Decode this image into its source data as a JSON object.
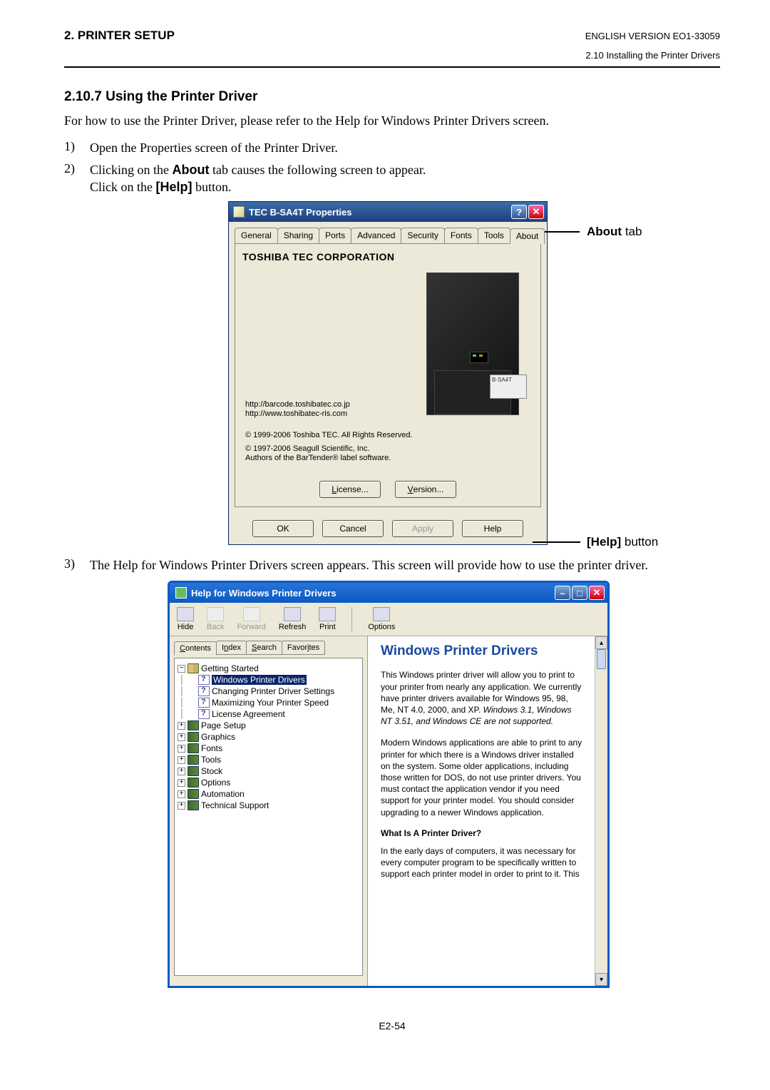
{
  "header": {
    "left": "2. PRINTER SETUP",
    "right_top": "ENGLISH VERSION EO1-33059",
    "right_sub": "2.10 Installing the Printer Drivers"
  },
  "section_title": "2.10.7  Using the Printer Driver",
  "intro": "For how to use the Printer Driver, please refer to the Help for Windows Printer Drivers screen.",
  "steps": {
    "s1": "Open the Properties screen of the Printer Driver.",
    "s2a": "Clicking on the ",
    "s2b_bold": "About",
    "s2c": " tab causes the following screen to appear.",
    "s2d": "Click on the ",
    "s2e_bold": "[Help]",
    "s2f": " button.",
    "s3": "The Help for Windows Printer Drivers screen appears.  This screen will provide how to use the printer driver."
  },
  "callout_about": "About",
  "callout_about_suffix": " tab",
  "callout_help": "[Help]",
  "callout_help_suffix": " button",
  "prop": {
    "title": "TEC B-SA4T Properties",
    "tabs": [
      "General",
      "Sharing",
      "Ports",
      "Advanced",
      "Security",
      "Fonts",
      "Tools",
      "About"
    ],
    "corp": "TOSHIBA TEC CORPORATION",
    "url1": "http://barcode.toshibatec.co.jp",
    "url2": "http://www.toshibatec-ris.com",
    "cr1": "© 1999-2006 Toshiba TEC.  All Rights Reserved.",
    "cr2a": "© 1997-2006 Seagull Scientific, Inc.",
    "cr2b": "Authors of the BarTender® label software.",
    "btn_license": "License...",
    "btn_version": "Version...",
    "btn_ok": "OK",
    "btn_cancel": "Cancel",
    "btn_apply": "Apply",
    "btn_help": "Help",
    "printer_label": "B-SA4T"
  },
  "help": {
    "title": "Help for Windows Printer Drivers",
    "toolbar": {
      "hide": "Hide",
      "back": "Back",
      "forward": "Forward",
      "refresh": "Refresh",
      "print": "Print",
      "options": "Options"
    },
    "navtabs": [
      "Contents",
      "Index",
      "Search",
      "Favorites"
    ],
    "tree": {
      "getting_started": "Getting Started",
      "wpd": "Windows Printer Drivers",
      "changing": "Changing Printer Driver Settings",
      "maximizing": "Maximizing Your Printer Speed",
      "license": "License Agreement",
      "page_setup": "Page Setup",
      "graphics": "Graphics",
      "fonts": "Fonts",
      "tools": "Tools",
      "stock": "Stock",
      "options": "Options",
      "automation": "Automation",
      "tech": "Technical Support"
    },
    "content": {
      "title": "Windows Printer Drivers",
      "p1a": "This Windows printer driver will allow you to print to your printer from nearly any application.  We currently have printer drivers available for Windows 95, 98, Me, NT 4.0, 2000, and XP.  ",
      "p1b_italic": "Windows 3.1, Windows NT 3.51, and Windows CE are not supported.",
      "p2": "Modern Windows applications are able to print to any printer for which there is a Windows driver installed on the system.  Some older applications, including those written for DOS, do not use printer drivers.  You must contact the application vendor if you need support for your printer model.  You should consider upgrading to a newer Windows application.",
      "sub": "What Is A Printer Driver?",
      "p3": "In the early days of computers, it was necessary for every computer program to be specifically written to support each printer model in order to print to it.  This"
    }
  },
  "page_num": "E2-54"
}
